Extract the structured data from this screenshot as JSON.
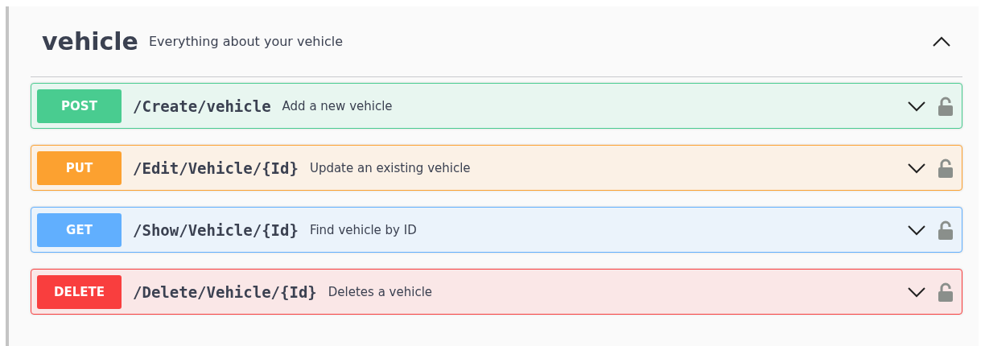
{
  "section": {
    "title": "vehicle",
    "description": "Everything about your vehicle",
    "expanded": true
  },
  "operations": [
    {
      "kind": "post",
      "method": "POST",
      "path": "/Create/vehicle",
      "summary": "Add a new vehicle",
      "expanded": false
    },
    {
      "kind": "put",
      "method": "PUT",
      "path": "/Edit/Vehicle/{Id}",
      "summary": "Update an existing vehicle",
      "expanded": false
    },
    {
      "kind": "get",
      "method": "GET",
      "path": "/Show/Vehicle/{Id}",
      "summary": "Find vehicle by ID",
      "expanded": false
    },
    {
      "kind": "delete",
      "method": "DELETE",
      "path": "/Delete/Vehicle/{Id}",
      "summary": "Deletes a vehicle",
      "expanded": false
    }
  ]
}
